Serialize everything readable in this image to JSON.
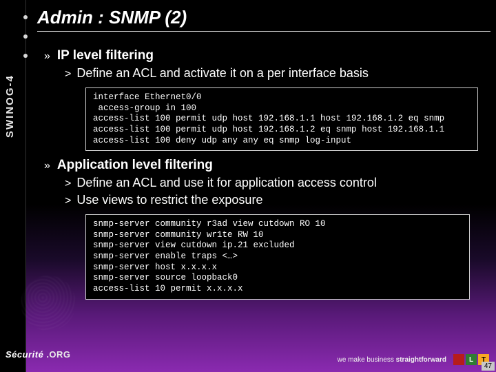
{
  "rail": {
    "label": "SWINOG-4"
  },
  "title": "Admin : SNMP (2)",
  "sections": [
    {
      "heading": "IP level filtering",
      "bullets": [
        "Define an ACL and activate it on a per interface basis"
      ],
      "code": "interface Ethernet0/0\n access-group in 100\naccess-list 100 permit udp host 192.168.1.1 host 192.168.1.2 eq snmp\naccess-list 100 permit udp host 192.168.1.2 eq snmp host 192.168.1.1\naccess-list 100 deny udp any any eq snmp log-input"
    },
    {
      "heading": "Application level filtering",
      "bullets": [
        "Define an ACL and use it for application access control",
        "Use views to restrict the exposure"
      ],
      "code": "snmp-server community r3ad view cutdown RO 10\nsnmp-server community wr1te RW 10\nsnmp-server view cutdown ip.21 excluded\nsnmp-server enable traps <…>\nsnmp-server host x.x.x.x\nsnmp-server source loopback0\naccess-list 10 permit x.x.x.x"
    }
  ],
  "footer": {
    "logo_left": "Sécurité",
    "logo_right": ".ORG",
    "strap_plain": "we make business ",
    "strap_bold": "straightforward",
    "tiles": [
      "",
      "L",
      "T"
    ],
    "page": "47"
  }
}
